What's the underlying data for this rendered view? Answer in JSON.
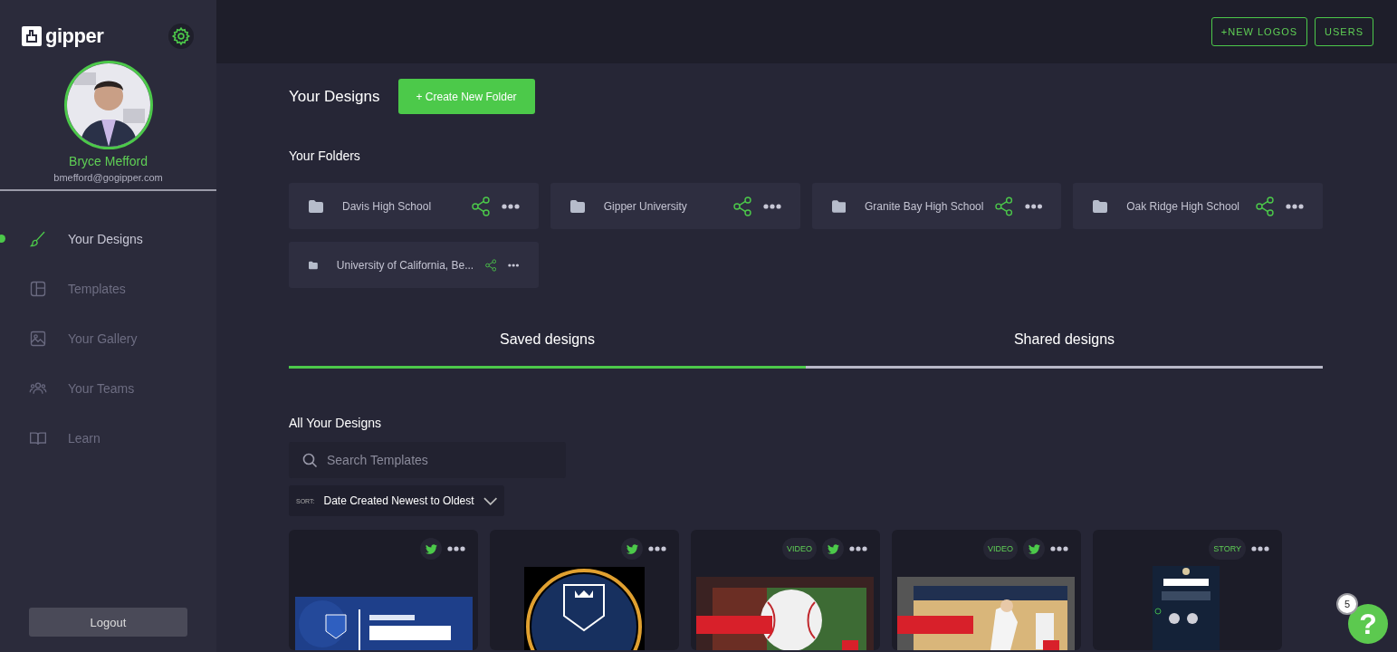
{
  "sidebar": {
    "logo": "gipper",
    "user": {
      "name": "Bryce Mefford",
      "email": "bmefford@gogipper.com"
    },
    "items": [
      {
        "label": "Your Designs",
        "selected": true
      },
      {
        "label": "Templates",
        "selected": false
      },
      {
        "label": "Your Gallery",
        "selected": false
      },
      {
        "label": "Your Teams",
        "selected": false
      },
      {
        "label": "Learn",
        "selected": false
      }
    ],
    "logout": "Logout"
  },
  "top_bar": {
    "buttons": [
      "+NEW LOGOS",
      "USERS"
    ]
  },
  "header": {
    "title": "Your Designs",
    "create_button": "+ Create New Folder"
  },
  "folders": {
    "title": "Your Folders",
    "items": [
      {
        "name": "Davis High School"
      },
      {
        "name": "Gipper University"
      },
      {
        "name": "Granite Bay High School"
      },
      {
        "name": "Oak Ridge High School"
      },
      {
        "name": "University of California, Be..."
      }
    ]
  },
  "tabs": [
    {
      "label": "Saved designs",
      "selected": true
    },
    {
      "label": "Shared designs",
      "selected": false
    }
  ],
  "designs": {
    "title": "All Your Designs",
    "search": {
      "placeholder": "Search Templates"
    },
    "sort": {
      "label": "SORT:",
      "value": "Date Created Newest to Oldest"
    },
    "items": [
      {
        "twitter": true
      },
      {
        "twitter": true
      },
      {
        "tag": "VIDEO",
        "twitter": true
      },
      {
        "tag": "VIDEO",
        "twitter": true
      },
      {
        "tag": "STORY",
        "twitter": false
      }
    ]
  },
  "help": {
    "label": "?",
    "badge": "5"
  }
}
